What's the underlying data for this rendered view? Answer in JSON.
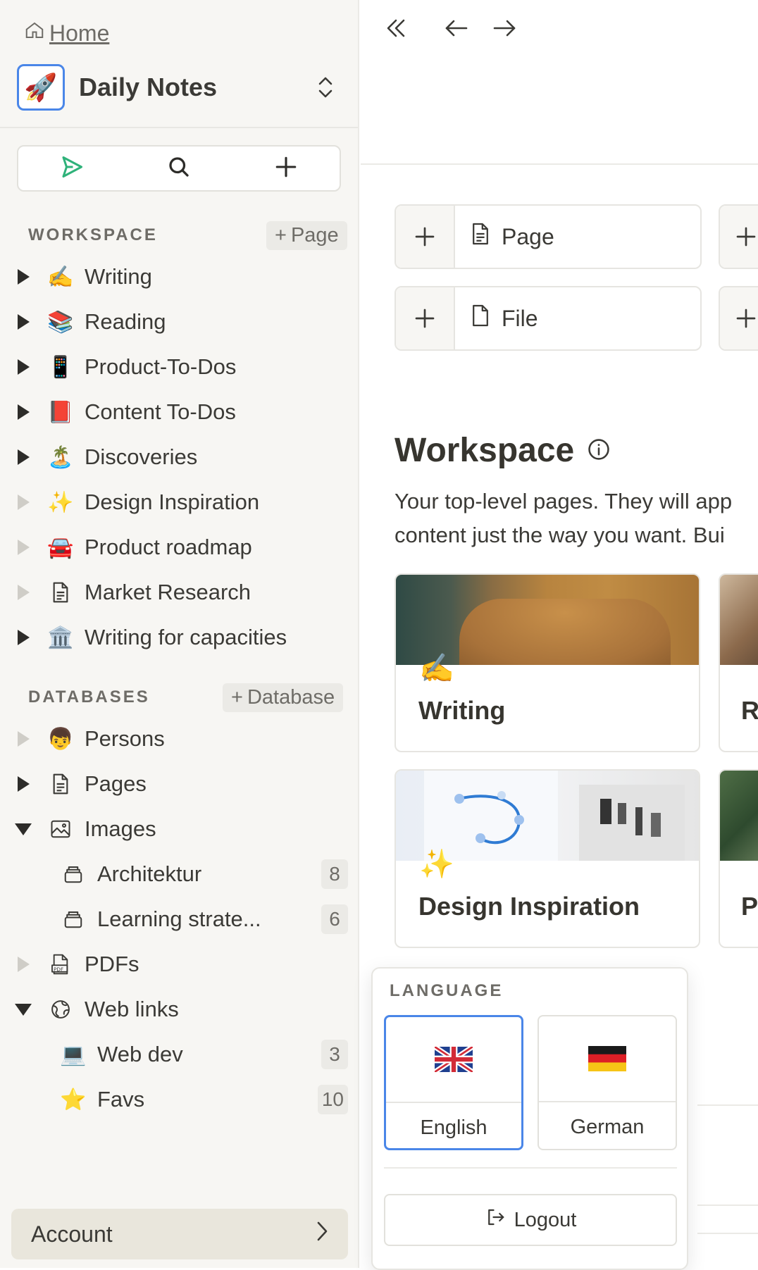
{
  "sidebar": {
    "home_label": "Home",
    "workspace_name": "Daily Notes",
    "workspace_logo": "🚀",
    "workspace_section": {
      "title": "WORKSPACE",
      "add_label": "Page"
    },
    "workspace_items": [
      {
        "icon": "✍️",
        "label": "Writing"
      },
      {
        "icon": "📚",
        "label": "Reading"
      },
      {
        "icon": "📱",
        "label": "Product-To-Dos"
      },
      {
        "icon": "📕",
        "label": "Content To-Dos"
      },
      {
        "icon": "🏝️",
        "label": "Discoveries"
      },
      {
        "icon": "✨",
        "label": "Design Inspiration"
      },
      {
        "icon": "🚘",
        "label": "Product roadmap"
      },
      {
        "icon": "page-icon",
        "label": "Market Research"
      },
      {
        "icon": "🏛️",
        "label": "Writing for capacities"
      }
    ],
    "databases_section": {
      "title": "DATABASES",
      "add_label": "Database"
    },
    "database_items": [
      {
        "icon": "👦",
        "label": "Persons"
      },
      {
        "icon": "page-icon",
        "label": "Pages"
      },
      {
        "icon": "image-icon",
        "label": "Images"
      },
      {
        "icon": "collection-icon",
        "label": "Architektur",
        "count": "8"
      },
      {
        "icon": "collection-icon",
        "label": "Learning strate...",
        "count": "6"
      },
      {
        "icon": "pdf-icon",
        "label": "PDFs"
      },
      {
        "icon": "globe-icon",
        "label": "Web links"
      },
      {
        "icon": "💻",
        "label": "Web dev",
        "count": "3"
      },
      {
        "icon": "⭐",
        "label": "Favs",
        "count": "10"
      }
    ],
    "account_label": "Account"
  },
  "main": {
    "quick_create": [
      {
        "label": "Page"
      },
      {
        "label": "File"
      }
    ],
    "workspace_heading": "Workspace",
    "workspace_desc_line1": "Your top-level pages. They will app",
    "workspace_desc_line2": "content just the way you want. Bui",
    "cards": [
      {
        "emoji": "✍️",
        "title": "Writing"
      },
      {
        "emoji": "✨",
        "title": "Design Inspiration"
      }
    ],
    "peek_titles": [
      "R",
      "P"
    ]
  },
  "language_menu": {
    "title": "LANGUAGE",
    "options": [
      {
        "flag": "uk-flag",
        "label": "English",
        "selected": true
      },
      {
        "flag": "german-flag",
        "label": "German",
        "selected": false
      }
    ],
    "logout_label": "Logout"
  },
  "colors": {
    "sidebar_bg": "#f7f6f3",
    "accent_blue": "#4a86e8",
    "send_green": "#2fb27a",
    "text": "#37352f"
  }
}
